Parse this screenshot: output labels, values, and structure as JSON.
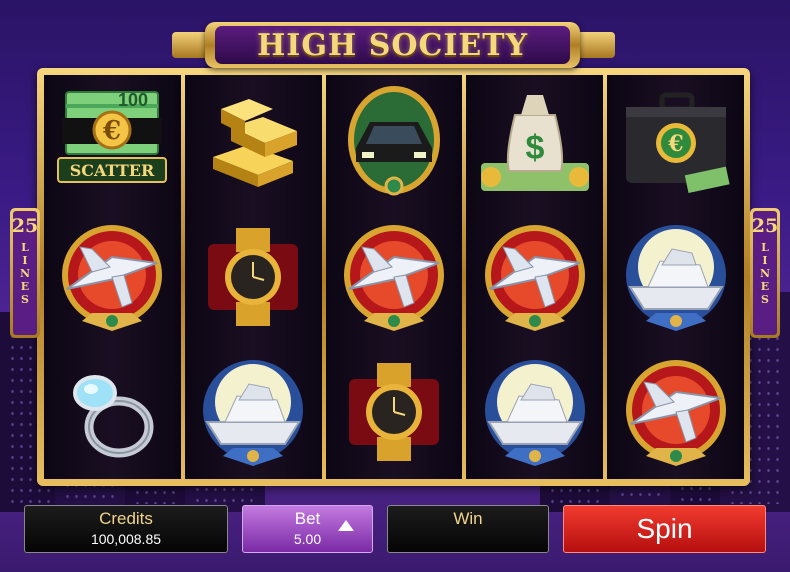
{
  "game": {
    "title": "HIGH SOCIETY"
  },
  "lines_indicator": {
    "left": {
      "count": "25",
      "label": "LINES"
    },
    "right": {
      "count": "25",
      "label": "LINES"
    }
  },
  "reels": [
    [
      {
        "symbol": "scatter-cash-stack",
        "text": "SCATTER",
        "note": "100"
      },
      {
        "symbol": "private-jet"
      },
      {
        "symbol": "diamond-ring"
      }
    ],
    [
      {
        "symbol": "gold-bars"
      },
      {
        "symbol": "gold-watch"
      },
      {
        "symbol": "yacht"
      }
    ],
    [
      {
        "symbol": "limousine"
      },
      {
        "symbol": "private-jet"
      },
      {
        "symbol": "gold-watch"
      }
    ],
    [
      {
        "symbol": "money-bag"
      },
      {
        "symbol": "private-jet"
      },
      {
        "symbol": "yacht"
      }
    ],
    [
      {
        "symbol": "money-briefcase"
      },
      {
        "symbol": "yacht"
      },
      {
        "symbol": "private-jet"
      }
    ]
  ],
  "controls": {
    "credits": {
      "label": "Credits",
      "value": "100,008.85"
    },
    "bet": {
      "label": "Bet",
      "value": "5.00"
    },
    "win": {
      "label": "Win",
      "value": ""
    },
    "spin": {
      "label": "Spin"
    }
  },
  "colors": {
    "accent_gold": "#f5d77c",
    "spin_red": "#d81e1e",
    "bet_purple": "#a34fd0"
  }
}
